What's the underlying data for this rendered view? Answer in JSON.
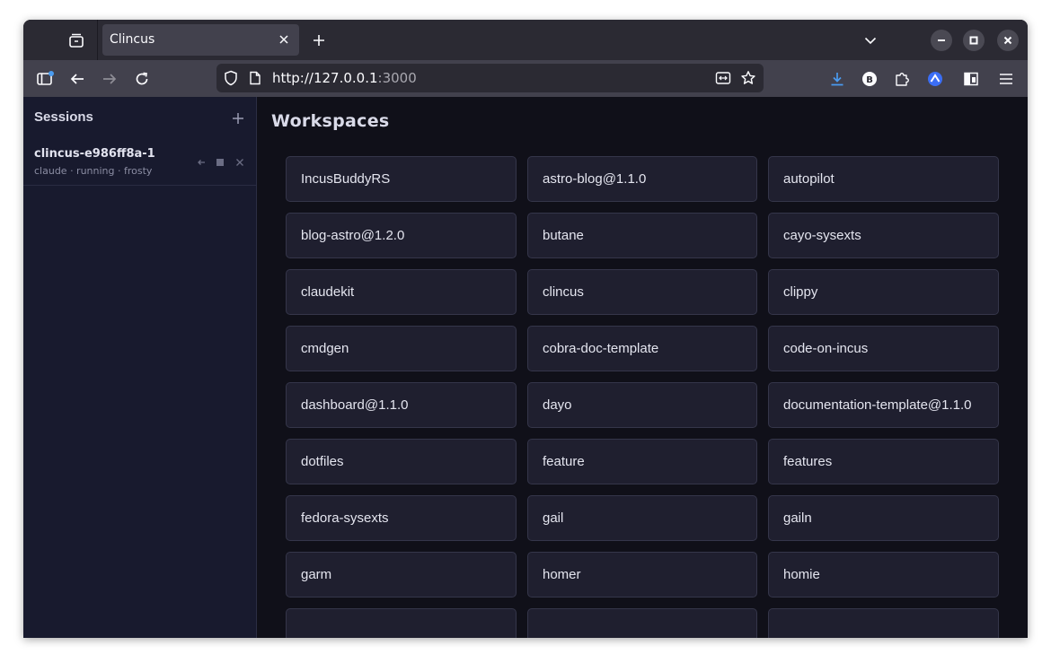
{
  "browser": {
    "tab_title": "Clincus",
    "url_host": "http://127.0.0.1",
    "url_port": ":3000"
  },
  "sidebar": {
    "heading": "Sessions",
    "sessions": [
      {
        "name": "clincus-e986ff8a-1",
        "meta": "claude · running · frosty"
      }
    ]
  },
  "main": {
    "title": "Workspaces",
    "workspaces": [
      "IncusBuddyRS",
      "astro-blog@1.1.0",
      "autopilot",
      "blog-astro@1.2.0",
      "butane",
      "cayo-sysexts",
      "claudekit",
      "clincus",
      "clippy",
      "cmdgen",
      "cobra-doc-template",
      "code-on-incus",
      "dashboard@1.1.0",
      "dayo",
      "documentation-template@1.1.0",
      "dotfiles",
      "feature",
      "features",
      "fedora-sysexts",
      "gail",
      "gailn",
      "garm",
      "homer",
      "homie",
      "",
      "",
      ""
    ]
  },
  "colors": {
    "sidebar_bg": "#181a2e",
    "main_bg": "#101019",
    "card_bg": "#1f1f2f",
    "accent_download": "#4a9bf0"
  }
}
